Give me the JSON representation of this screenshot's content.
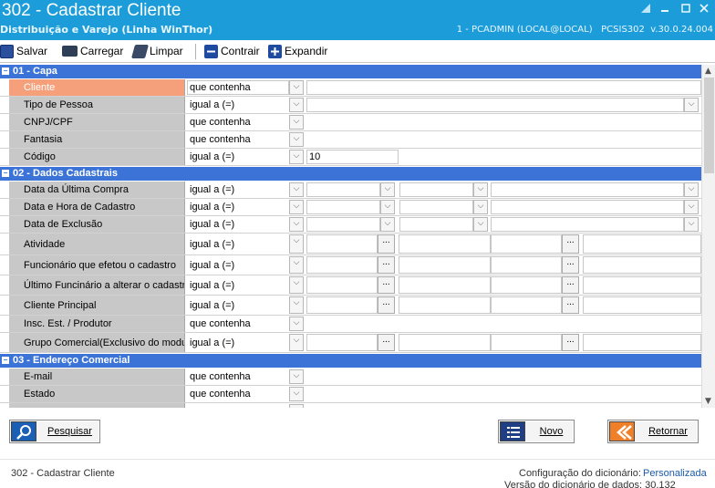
{
  "window": {
    "title": "302 - Cadastrar Cliente",
    "subtitle": "Distribuição e Varejo (Linha WinThor)",
    "session": "1 - PCADMIN (LOCAL@LOCAL)   PCSIS302  v.30.0.24.004"
  },
  "toolbar": {
    "salvar": "Salvar",
    "carregar": "Carregar",
    "limpar": "Limpar",
    "contrair": "Contrair",
    "expandir": "Expandir"
  },
  "sections": {
    "capa": "01 - Capa",
    "dados": "02 - Dados Cadastrais",
    "endereco": "03 - Endereço Comercial"
  },
  "rows": {
    "cliente": {
      "label": "Cliente",
      "op": "que contenha"
    },
    "tipo_pessoa": {
      "label": "Tipo de Pessoa",
      "op": "igual a (=)"
    },
    "cnpj": {
      "label": "CNPJ/CPF",
      "op": "que contenha"
    },
    "fantasia": {
      "label": "Fantasia",
      "op": "que contenha"
    },
    "codigo": {
      "label": "Código",
      "op": "igual a (=)",
      "value": "10"
    },
    "ultima_compra": {
      "label": "Data da Última Compra",
      "op": "igual a (=)"
    },
    "data_cadastro": {
      "label": "Data e Hora de Cadastro",
      "op": "igual a (=)"
    },
    "data_exclusao": {
      "label": "Data de Exclusão",
      "op": "igual a (=)"
    },
    "atividade": {
      "label": "Atividade",
      "op": "igual a (=)"
    },
    "funcionario_cadastro": {
      "label": "Funcionário que efetou o cadastro",
      "op": "igual a (=)"
    },
    "ultimo_funcionario": {
      "label": "Último Funcinário a alterar o cadastro",
      "op": "igual a (=)"
    },
    "cliente_principal": {
      "label": "Cliente Principal",
      "op": "igual a (=)"
    },
    "insc_est": {
      "label": "Insc. Est. / Produtor",
      "op": "que contenha"
    },
    "grupo_comercial": {
      "label": "Grupo Comercial(Exclusivo do modulo",
      "op": "igual a (=)"
    },
    "email": {
      "label": "E-mail",
      "op": "que contenha"
    },
    "estado": {
      "label": "Estado",
      "op": "que contenha"
    }
  },
  "icons": {
    "ellipsis": "...",
    "chevron": "⌵"
  },
  "buttons": {
    "pesquisar": "Pesquisar",
    "novo": "Novo",
    "retornar": "Retornar"
  },
  "status": {
    "screen": "302 - Cadastrar Cliente",
    "config_label": "Configuração do dicionário:",
    "config_value": "Personalizada",
    "version_text": "Versão do dicionário de dados: 30.132"
  },
  "colors": {
    "titlebar": "#1c9dd9",
    "section_header": "#3b73d6",
    "selected_label": "#f5a07a",
    "link": "#1b5aa8"
  }
}
